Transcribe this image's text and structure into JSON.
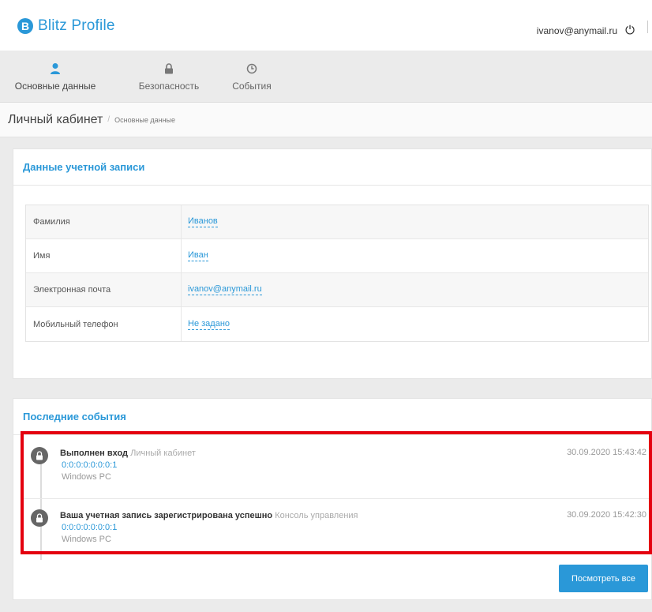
{
  "header": {
    "logo_letter": "B",
    "app_name": "Blitz Profile",
    "user_email": "ivanov@anymail.ru",
    "power_icon": "⏻"
  },
  "tabs": [
    {
      "label": "Основные данные",
      "icon": "user-icon",
      "active": true
    },
    {
      "label": "Безопасность",
      "icon": "lock-icon",
      "active": false
    },
    {
      "label": "События",
      "icon": "clock-icon",
      "active": false
    }
  ],
  "breadcrumb": {
    "title": "Личный кабинет",
    "separator": "/",
    "current": "Основные данные"
  },
  "account": {
    "heading": "Данные учетной записи",
    "rows": [
      {
        "label": "Фамилия",
        "value": "Иванов"
      },
      {
        "label": "Имя",
        "value": "Иван"
      },
      {
        "label": "Электронная почта",
        "value": "ivanov@anymail.ru"
      },
      {
        "label": "Мобильный телефон",
        "value": "Не задано"
      }
    ]
  },
  "events": {
    "heading": "Последние события",
    "items": [
      {
        "title": "Выполнен вход",
        "source": "Личный кабинет",
        "ip": "0:0:0:0:0:0:0:1",
        "os": "Windows PC",
        "time": "30.09.2020 15:43:42"
      },
      {
        "title": "Ваша учетная запись зарегистрирована успешно",
        "source": "Консоль управления",
        "ip": "0:0:0:0:0:0:0:1",
        "os": "Windows PC",
        "time": "30.09.2020 15:42:30"
      }
    ],
    "view_all_label": "Посмотреть все"
  },
  "colors": {
    "accent": "#2a98d8",
    "highlight": "#e4000f"
  }
}
